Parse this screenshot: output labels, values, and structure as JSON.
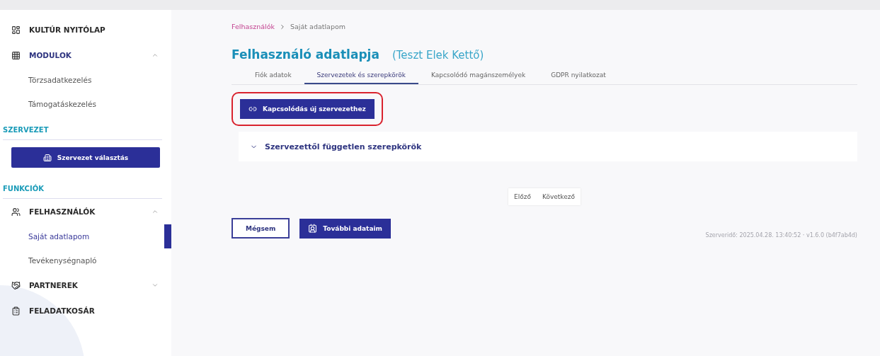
{
  "sidebar": {
    "items": [
      {
        "kind": "link",
        "label": "KULTÚR NYITÓLAP"
      },
      {
        "kind": "group",
        "label": "MODULOK",
        "expanded": true,
        "children": [
          {
            "label": "Törzsadatkezelés",
            "selected": false
          },
          {
            "label": "Támogatáskezelés",
            "selected": false
          }
        ]
      },
      {
        "kind": "section",
        "label": "SZERVEZET"
      },
      {
        "kind": "button",
        "label": "Szervezet választás"
      },
      {
        "kind": "section",
        "label": "FUNKCIÓK"
      },
      {
        "kind": "group",
        "label": "FELHASZNÁLÓK",
        "expanded": true,
        "children": [
          {
            "label": "Saját adatlapom",
            "selected": true
          },
          {
            "label": "Tevékenységnapló",
            "selected": false
          }
        ]
      },
      {
        "kind": "group",
        "label": "PARTNEREK",
        "expanded": false
      },
      {
        "kind": "link",
        "label": "FELADATKOSÁR"
      }
    ]
  },
  "breadcrumb": [
    {
      "label": "Felhasználók"
    },
    {
      "label": "Saját adatlapom"
    }
  ],
  "page": {
    "title": "Felhasználó adatlapja",
    "subtitle": "(Teszt Elek Kettő)"
  },
  "tabs": [
    {
      "label": "Fiók adatok",
      "selected": false
    },
    {
      "label": "Szervezetek és szerepkörök",
      "selected": true
    },
    {
      "label": "Kapcsolódó magánszemélyek",
      "selected": false
    },
    {
      "label": "GDPR nyilatkozat",
      "selected": false
    }
  ],
  "connect_button": {
    "label": "Kapcsolódás új szervezethez",
    "highlighted": true
  },
  "accordion": {
    "title": "Szervezettől független szerepkörök",
    "expanded": false
  },
  "pagination": [
    "Előző",
    "Következő"
  ],
  "actions": [
    {
      "kind": "outline",
      "label": "Mégsem"
    },
    {
      "kind": "primary",
      "label": "További adataim"
    }
  ],
  "footer": "Szerveridő: 2025.04.28. 13:40:52 · v1.6.0 (b4f7ab4d)"
}
